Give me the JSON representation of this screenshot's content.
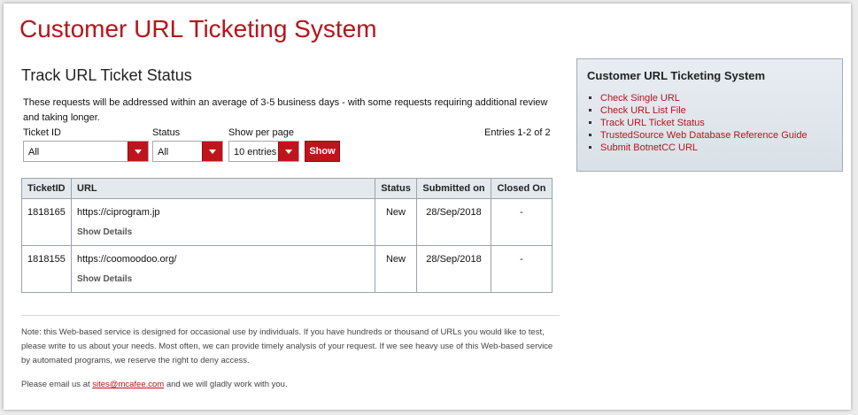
{
  "header": {
    "title": "Customer URL Ticketing System"
  },
  "main": {
    "section_title": "Track URL Ticket Status",
    "intro": "These requests will be addressed within an average of 3-5 business days - with some requests requiring additional review and taking longer.",
    "filters": {
      "ticket_id": {
        "label": "Ticket ID",
        "value": "All"
      },
      "status": {
        "label": "Status",
        "value": "All"
      },
      "per_page": {
        "label": "Show per page",
        "value": "10 entries"
      },
      "show_button": "Show"
    },
    "entries_text": "Entries 1-2 of 2",
    "table": {
      "columns": [
        "TicketID",
        "URL",
        "Status",
        "Submitted on",
        "Closed On"
      ],
      "rows": [
        {
          "ticket_id": "1818165",
          "url": "https://ciprogram.jp",
          "details": "Show Details",
          "status": "New",
          "submitted": "28/Sep/2018",
          "closed": "-"
        },
        {
          "ticket_id": "1818155",
          "url": "https://coomoodoo.org/",
          "details": "Show Details",
          "status": "New",
          "submitted": "28/Sep/2018",
          "closed": "-"
        }
      ]
    },
    "note": "Note: this Web-based service is designed for occasional use by individuals. If you have hundreds or thousand of URLs you would like to test, please write to us about your needs. Most often, we can provide timely analysis of your request. If we see heavy use of this Web-based service by automated programs, we reserve the right to deny access.",
    "email": {
      "prefix": "Please email us at ",
      "address": "sites@mcafee.com",
      "suffix": " and we will gladly work with you."
    }
  },
  "sidebar": {
    "title": "Customer URL Ticketing System",
    "links": [
      "Check Single URL",
      "Check URL List File",
      "Track URL Ticket Status",
      "TrustedSource Web Database Reference Guide",
      "Submit BotnetCC URL"
    ]
  },
  "colors": {
    "accent": "#b5151c",
    "button": "#c0141d",
    "sidebar_bg": "#dde3e9"
  }
}
